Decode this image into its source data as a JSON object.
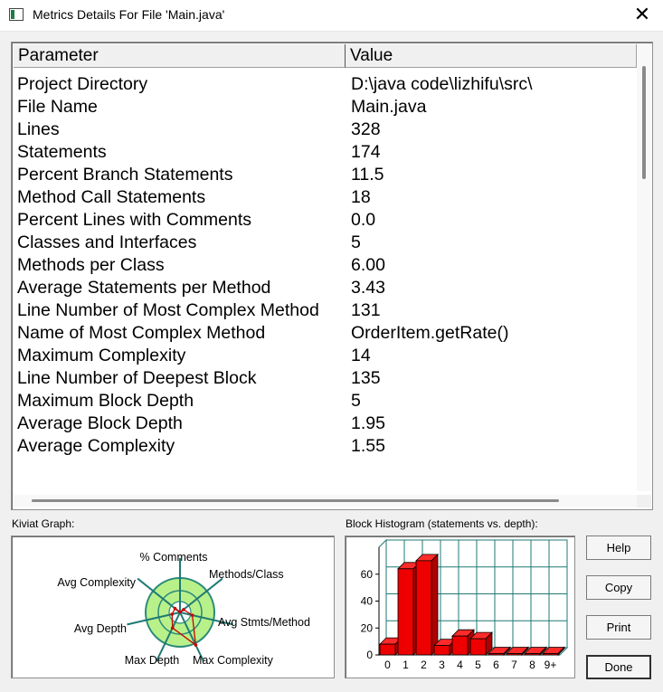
{
  "window": {
    "title": "Metrics Details For File 'Main.java'",
    "close_glyph": "✕",
    "icon": "window-app-icon"
  },
  "table": {
    "headers": {
      "param": "Parameter",
      "value": "Value"
    },
    "rows": [
      {
        "param": "Project Directory",
        "value": "D:\\java code\\lizhifu\\src\\"
      },
      {
        "param": "File Name",
        "value": "Main.java"
      },
      {
        "param": "Lines",
        "value": "328"
      },
      {
        "param": "Statements",
        "value": "174"
      },
      {
        "param": "Percent Branch Statements",
        "value": "11.5"
      },
      {
        "param": "Method Call Statements",
        "value": "18"
      },
      {
        "param": "Percent Lines with Comments",
        "value": "0.0"
      },
      {
        "param": "Classes and Interfaces",
        "value": "5"
      },
      {
        "param": "Methods per Class",
        "value": "6.00"
      },
      {
        "param": "Average Statements per Method",
        "value": "3.43"
      },
      {
        "param": "Line Number of Most Complex Method",
        "value": "131"
      },
      {
        "param": "Name of Most Complex Method",
        "value": "OrderItem.getRate()"
      },
      {
        "param": "Maximum Complexity",
        "value": "14"
      },
      {
        "param": "Line Number of Deepest Block",
        "value": "135"
      },
      {
        "param": "Maximum Block Depth",
        "value": "5"
      },
      {
        "param": "Average Block Depth",
        "value": "1.95"
      },
      {
        "param": "Average Complexity",
        "value": "1.55"
      }
    ]
  },
  "kiviat": {
    "label": "Kiviat Graph:",
    "axes": [
      "% Comments",
      "Methods/Class",
      "Avg Stmts/Method",
      "Max Complexity",
      "Max Depth",
      "Avg Depth",
      "Avg Complexity"
    ],
    "colors": {
      "band": "#b8f08a",
      "ring": "#2a8a7a",
      "spoke": "#1f7a74",
      "polygon": "#cc0000"
    }
  },
  "histogram": {
    "label": "Block Histogram (statements vs. depth):",
    "colors": {
      "bar": "#ee0000",
      "grid": "#1f7a74"
    }
  },
  "chart_data": {
    "type": "bar",
    "title": "Block Histogram (statements vs. depth):",
    "categories": [
      "0",
      "1",
      "2",
      "3",
      "4",
      "5",
      "6",
      "7",
      "8",
      "9+"
    ],
    "values": [
      8,
      64,
      70,
      7,
      14,
      12,
      1,
      1,
      1,
      1
    ],
    "ylim": [
      0,
      80
    ],
    "yticks": [
      "0",
      "20",
      "40",
      "60"
    ]
  },
  "buttons": {
    "help": "Help",
    "copy": "Copy",
    "print": "Print",
    "done": "Done"
  }
}
